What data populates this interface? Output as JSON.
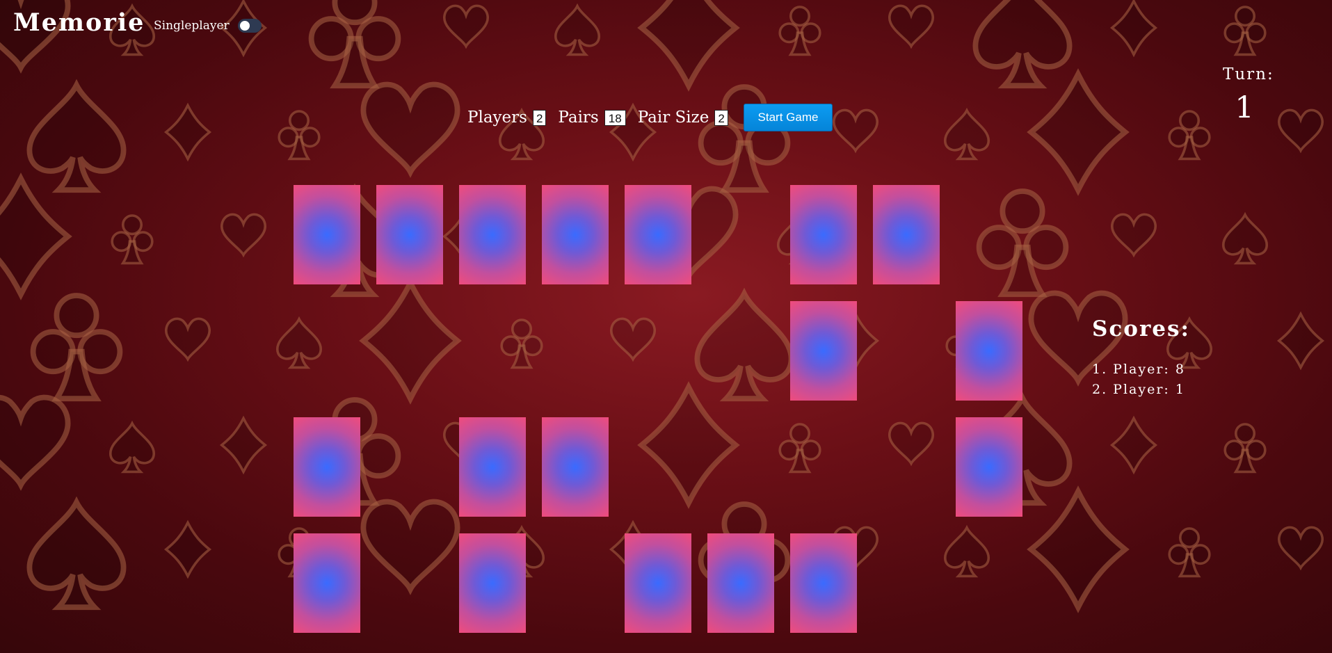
{
  "header": {
    "title": "Memorie",
    "mode_label": "Singleplayer",
    "singleplayer_enabled": false
  },
  "settings": {
    "players_label": "Players",
    "players_value": "2",
    "pairs_label": "Pairs",
    "pairs_value": "18",
    "pair_size_label": "Pair Size",
    "pair_size_value": "2",
    "start_label": "Start Game"
  },
  "turn": {
    "label": "Turn:",
    "value": "1"
  },
  "scores": {
    "title": "Scores:",
    "entries": [
      "1. Player: 8",
      "2. Player: 1"
    ]
  },
  "board": {
    "columns": 9,
    "rows": 4,
    "cells": [
      [
        true,
        true,
        true,
        true,
        true,
        false,
        true,
        true,
        false
      ],
      [
        false,
        false,
        false,
        false,
        false,
        false,
        true,
        false,
        true
      ],
      [
        true,
        false,
        true,
        true,
        false,
        false,
        false,
        false,
        true
      ],
      [
        true,
        false,
        true,
        false,
        true,
        true,
        true,
        false,
        false
      ]
    ]
  },
  "colors": {
    "background": "#6a0f16",
    "card_center": "#3a6bff",
    "card_edge": "#f04c7c",
    "start_button": "#0c9cf2",
    "suit_pattern": "#a06040"
  },
  "icons": [
    "heart-icon",
    "spade-icon",
    "diamond-icon",
    "club-icon"
  ]
}
